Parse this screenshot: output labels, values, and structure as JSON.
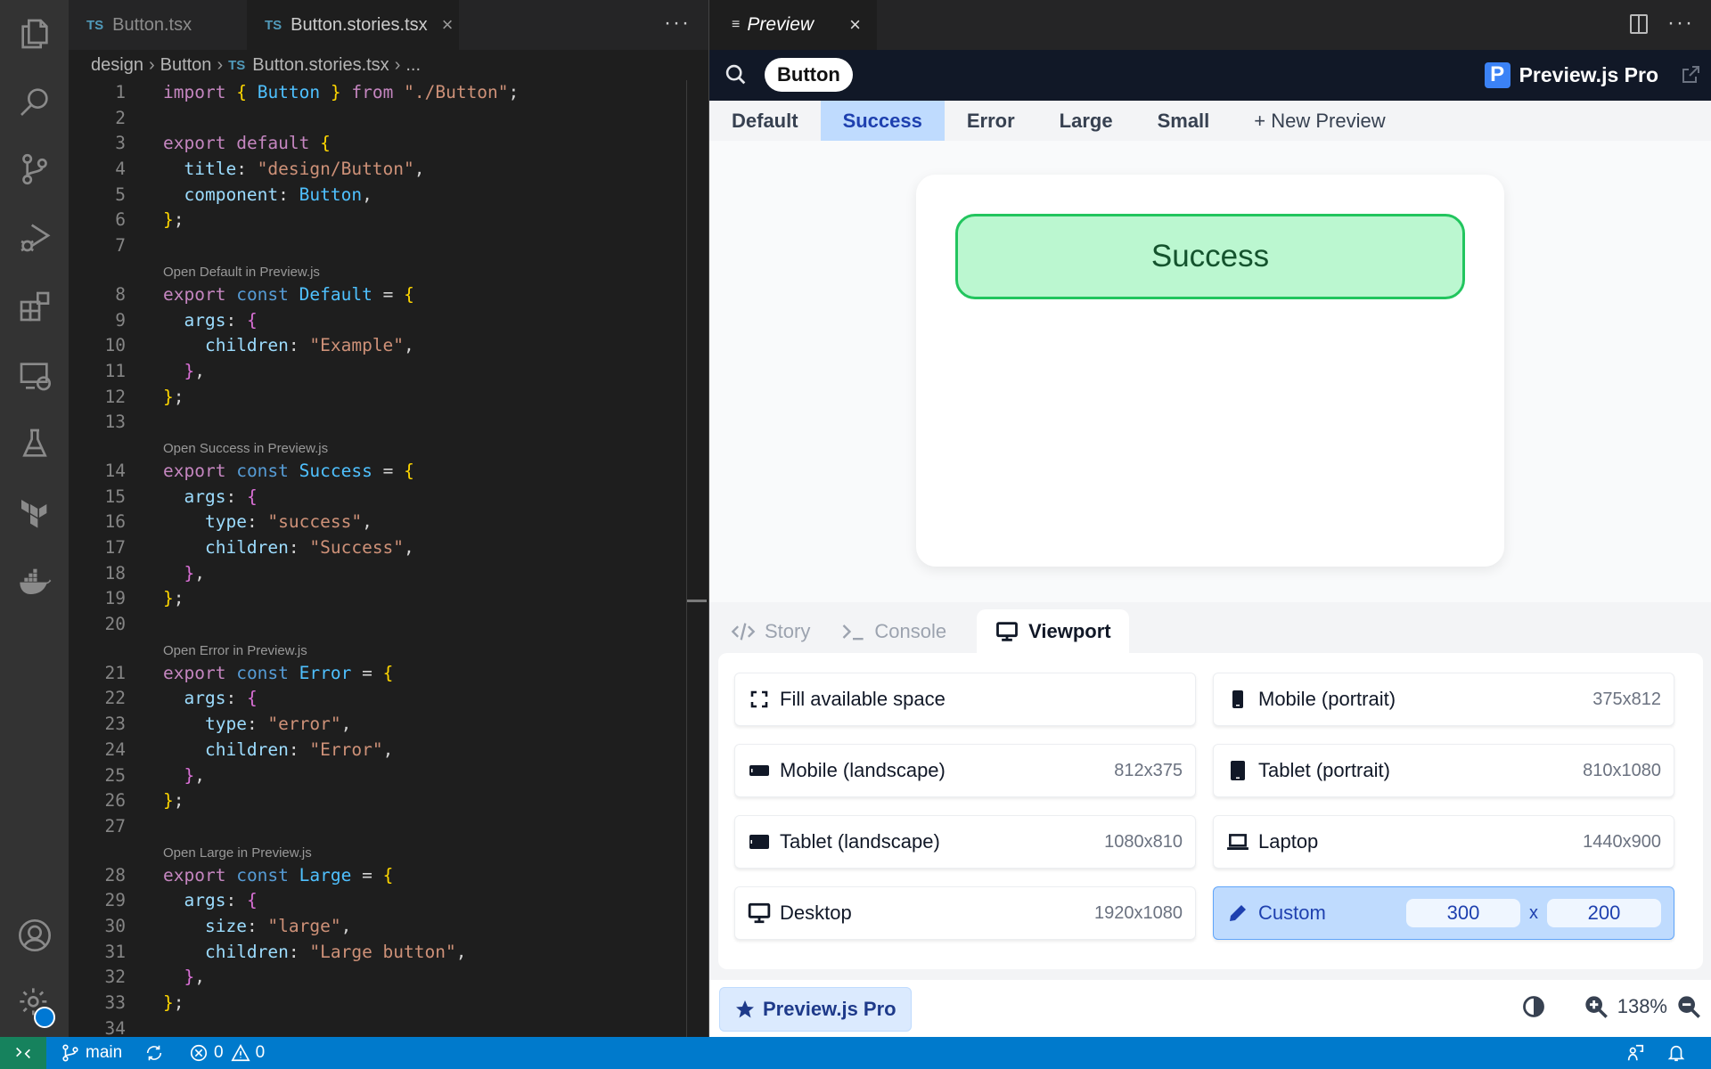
{
  "activity_bar": {
    "items": [
      {
        "icon": "explorer-icon"
      },
      {
        "icon": "search-icon"
      },
      {
        "icon": "source-control-icon"
      },
      {
        "icon": "run-debug-icon"
      },
      {
        "icon": "extensions-icon"
      },
      {
        "icon": "remote-explorer-icon"
      },
      {
        "icon": "testing-icon"
      },
      {
        "icon": "terraform-icon"
      },
      {
        "icon": "docker-icon"
      }
    ],
    "bottom": [
      {
        "icon": "accounts-icon"
      },
      {
        "icon": "manage-gear-icon"
      }
    ]
  },
  "editor": {
    "tabs": [
      {
        "badge": "TS",
        "label": "Button.tsx",
        "active": false
      },
      {
        "badge": "TS",
        "label": "Button.stories.tsx",
        "active": true,
        "close": "×"
      }
    ],
    "more": "···",
    "breadcrumb": {
      "parts": [
        "design",
        "Button"
      ],
      "file_badge": "TS",
      "file": "Button.stories.tsx",
      "tail": "..."
    },
    "code_lens": {
      "default": "Open Default in Preview.js",
      "success": "Open Success in Preview.js",
      "error": "Open Error in Preview.js",
      "large": "Open Large in Preview.js"
    },
    "lines": [
      "import { Button } from \"./Button\";",
      "",
      "export default {",
      "  title: \"design/Button\",",
      "  component: Button,",
      "};",
      "",
      "export const Default = {",
      "  args: {",
      "    children: \"Example\",",
      "  },",
      "};",
      "",
      "export const Success = {",
      "  args: {",
      "    type: \"success\",",
      "    children: \"Success\",",
      "  },",
      "};",
      "",
      "export const Error = {",
      "  args: {",
      "    type: \"error\",",
      "    children: \"Error\",",
      "  },",
      "};",
      "",
      "export const Large = {",
      "  args: {",
      "    size: \"large\",",
      "    children: \"Large button\",",
      "  },",
      "};",
      ""
    ]
  },
  "preview": {
    "tab_label": "Preview",
    "tab_close": "×",
    "more": "···",
    "search_pill": "Button",
    "brand": "Preview.js Pro",
    "brand_logo": "P",
    "story_tabs": [
      "Default",
      "Success",
      "Error",
      "Large",
      "Small"
    ],
    "active_story": "Success",
    "new_preview": "+ New Preview",
    "rendered_button": "Success",
    "bottom_tabs": [
      {
        "icon": "code-icon",
        "label": "Story"
      },
      {
        "icon": "terminal-icon",
        "label": "Console"
      },
      {
        "icon": "monitor-icon",
        "label": "Viewport",
        "active": true
      }
    ],
    "viewports": [
      {
        "icon": "fill-space-icon",
        "label": "Fill available space",
        "dims": ""
      },
      {
        "icon": "mobile-portrait-icon",
        "label": "Mobile (portrait)",
        "dims": "375x812"
      },
      {
        "icon": "mobile-landscape-icon",
        "label": "Mobile (landscape)",
        "dims": "812x375"
      },
      {
        "icon": "tablet-portrait-icon",
        "label": "Tablet (portrait)",
        "dims": "810x1080"
      },
      {
        "icon": "tablet-landscape-icon",
        "label": "Tablet (landscape)",
        "dims": "1080x810"
      },
      {
        "icon": "laptop-icon",
        "label": "Laptop",
        "dims": "1440x900"
      },
      {
        "icon": "desktop-icon",
        "label": "Desktop",
        "dims": "1920x1080"
      }
    ],
    "custom": {
      "label": "Custom",
      "width": "300",
      "height": "200",
      "sep": "x"
    },
    "pro_button": "Preview.js Pro",
    "zoom_level": "138%"
  },
  "status_bar": {
    "branch": "main",
    "errors": "0",
    "warnings": "0"
  },
  "colors": {
    "status_bar": "#007acc",
    "remote": "#16825d",
    "active_story_tab": "#bfdbfe",
    "success_bg": "#bbf7d0",
    "success_border": "#22c55e"
  }
}
